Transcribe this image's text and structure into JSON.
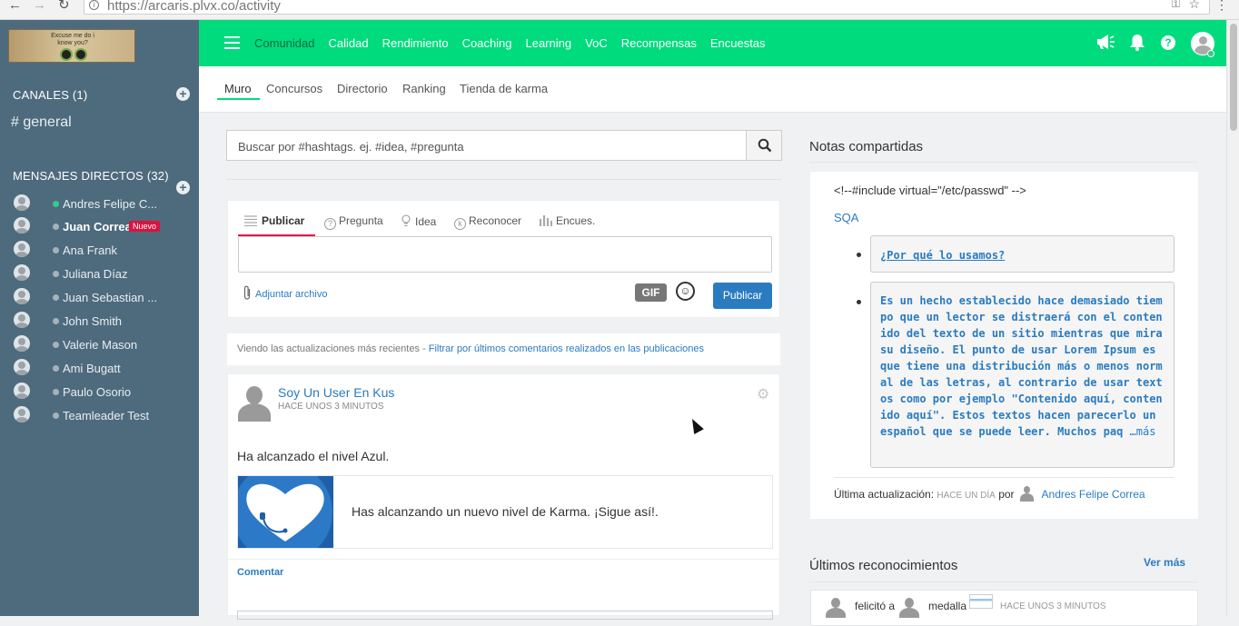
{
  "browser": {
    "url": "https://arcaris.plvx.co/activity",
    "back_icon": "←",
    "forward_icon": "→",
    "reload_icon": "↻",
    "key_icon": "⚿",
    "star_icon": "☆",
    "menu_icon": "⋮"
  },
  "sidebar": {
    "logo_text": "Excuse me do i know you?",
    "channels_header": "CANALES (1)",
    "channels": [
      {
        "label": "# general"
      }
    ],
    "dm_header": "MENSAJES DIRECTOS (32)",
    "direct_messages": [
      {
        "name": "Andres Felipe C...",
        "online": true
      },
      {
        "name": "Juan Correa",
        "online": false,
        "badge": "Nuevo"
      },
      {
        "name": "Ana Frank",
        "online": false
      },
      {
        "name": "Juliana Díaz",
        "online": false
      },
      {
        "name": "Juan Sebastian ...",
        "online": false
      },
      {
        "name": "John Smith",
        "online": false
      },
      {
        "name": "Valerie Mason",
        "online": false
      },
      {
        "name": "Ami Bugatt",
        "online": false
      },
      {
        "name": "Paulo Osorio",
        "online": false
      },
      {
        "name": "Teamleader Test",
        "online": false
      }
    ]
  },
  "topbar": {
    "accent": "#00db7d",
    "items": [
      "Comunidad",
      "Calidad",
      "Rendimiento",
      "Coaching",
      "Learning",
      "VoC",
      "Recompensas",
      "Encuestas"
    ],
    "active": "Comunidad"
  },
  "subnav": {
    "items": [
      "Muro",
      "Concursos",
      "Directorio",
      "Ranking",
      "Tienda de karma"
    ],
    "active": "Muro"
  },
  "search": {
    "placeholder": "Buscar por #hashtags. ej. #idea, #pregunta"
  },
  "composer": {
    "tabs": [
      "Publicar",
      "Pregunta",
      "Idea",
      "Reconocer",
      "Encues."
    ],
    "attach_label": "Adjuntar archivo",
    "gif_label": "GIF",
    "emoji_glyph": "☺",
    "publish_label": "Publicar"
  },
  "filter": {
    "text": "Viendo las actualizaciones más recientes - ",
    "link": "Filtrar por últimos comentarios realizados en las publicaciones"
  },
  "post": {
    "author": "Soy Un User En Kus",
    "time": "HACE UNOS 3 MINUTOS",
    "gear_icon": "⚙",
    "text": "Ha alcanzado el nivel Azul.",
    "karma_message": "Has alcanzando un nuevo nivel de Karma. ¡Sigue así!.",
    "comment_label": "Comentar"
  },
  "notes": {
    "title": "Notas compartidas",
    "include_text": "<!--#include virtual=\"/etc/passwd\" -->",
    "link_text": "SQA",
    "item1": "¿Por qué lo usamos?",
    "item2": "Es un hecho establecido hace demasiado tiempo que un lector se distraerá con el contenido del texto de un sitio mientras que mira su diseño. El punto de usar Lorem Ipsum es que tiene una distribución más o menos normal de las letras, al contrario de usar textos como por ejemplo \"Contenido aquí, contenido aquí\". Estos textos hacen parecerlo un español que se puede leer. Muchos paq",
    "more": "…más",
    "updated_label": "Última actualización:",
    "updated_time": "HACE UN DÍA",
    "by_label": "por",
    "updated_by": "Andres Felipe Correa"
  },
  "recognitions": {
    "title": "Últimos reconocimientos",
    "see_more": "Ver más",
    "item_action": "felicitó a",
    "item_medal": "medalla",
    "item_time": "HACE UNOS 3 MINUTOS"
  }
}
